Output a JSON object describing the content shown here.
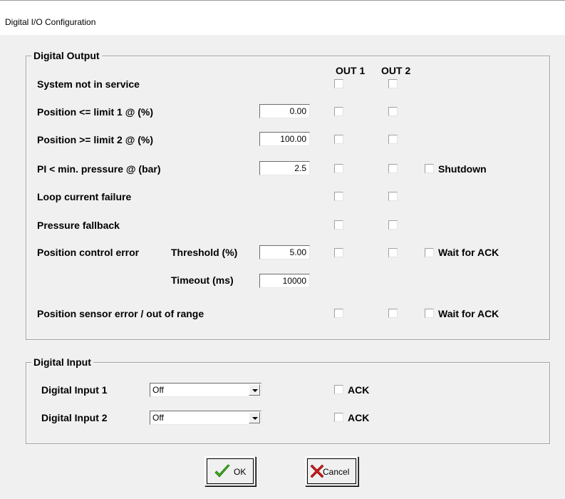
{
  "window": {
    "title": "Digital I/O Configuration"
  },
  "digital_output": {
    "legend": "Digital Output",
    "col_out1": "OUT 1",
    "col_out2": "OUT 2",
    "rows": {
      "not_in_service": {
        "label": "System not in service"
      },
      "pos_limit1": {
        "label": "Position <= limit 1 @ (%)",
        "value": "0.00"
      },
      "pos_limit2": {
        "label": "Position >= limit 2 @ (%)",
        "value": "100.00"
      },
      "pi_min_pressure": {
        "label": "PI < min. pressure @ (bar)",
        "value": "2.5",
        "extra_label": "Shutdown"
      },
      "loop_current": {
        "label": "Loop current failure"
      },
      "pressure_fallback": {
        "label": "Pressure fallback"
      },
      "pos_control_error": {
        "label": "Position control error",
        "threshold_label": "Threshold (%)",
        "threshold_value": "5.00",
        "extra_label": "Wait for ACK",
        "timeout_label": "Timeout (ms)",
        "timeout_value": "10000"
      },
      "pos_sensor_error": {
        "label": "Position sensor error / out of range",
        "extra_label": "Wait for ACK"
      }
    }
  },
  "digital_input": {
    "legend": "Digital Input",
    "input1": {
      "label": "Digital Input 1",
      "selected": "Off",
      "ack_label": "ACK"
    },
    "input2": {
      "label": "Digital Input 2",
      "selected": "Off",
      "ack_label": "ACK"
    }
  },
  "buttons": {
    "ok_label": "OK",
    "cancel_label": "Cancel"
  },
  "colors": {
    "background": "#f0f0f0",
    "ok_check": "#3cb01e",
    "cancel_x": "#d11a1a"
  },
  "icons": {
    "ok": "green-checkmark-icon",
    "cancel": "red-x-icon"
  }
}
